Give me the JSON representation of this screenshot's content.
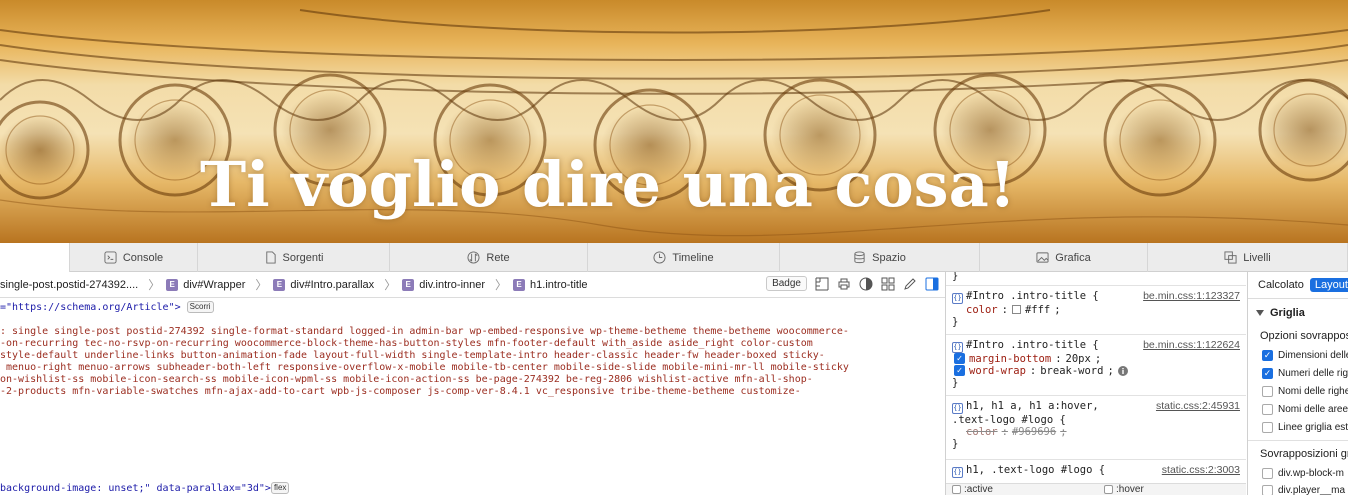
{
  "hero": {
    "title": "Ti voglio dire una cosa!"
  },
  "tabs": [
    {
      "label": "",
      "icon": "elements-icon"
    },
    {
      "label": "Console",
      "icon": "console-icon"
    },
    {
      "label": "Sorgenti",
      "icon": "document-icon"
    },
    {
      "label": "Rete",
      "icon": "network-icon"
    },
    {
      "label": "Timeline",
      "icon": "clock-icon"
    },
    {
      "label": "Spazio",
      "icon": "storage-icon"
    },
    {
      "label": "Grafica",
      "icon": "image-icon"
    },
    {
      "label": "Livelli",
      "icon": "layers-icon"
    }
  ],
  "breadcrumb": {
    "items": [
      {
        "label": "single-post.postid-274392....",
        "has_badge": false
      },
      {
        "label": "div#Wrapper",
        "has_badge": true
      },
      {
        "label": "div#Intro.parallax",
        "has_badge": true
      },
      {
        "label": "div.intro-inner",
        "has_badge": true
      },
      {
        "label": "h1.intro-title",
        "has_badge": true
      }
    ],
    "badge_letter": "E",
    "badge_button": "Badge"
  },
  "dom": {
    "line1_attr": "=\"https://schema.org/Article\">",
    "line1_pill": "Scorri",
    "class_lines": [
      ": single single-post postid-274392 single-format-standard logged-in admin-bar wp-embed-responsive wp-theme-betheme theme-betheme woocommerce-",
      "-on-recurring tec-no-rsvp-on-recurring woocommerce-block-theme-has-button-styles mfn-footer-default with_aside aside_right color-custom",
      "style-default underline-links button-animation-fade layout-full-width single-template-intro header-classic header-fw header-boxed sticky-",
      " menuo-right menuo-arrows subheader-both-left responsive-overflow-x-mobile mobile-tb-center mobile-side-slide mobile-mini-mr-ll mobile-sticky",
      "on-wishlist-ss mobile-icon-search-ss mobile-icon-wpml-ss mobile-icon-action-ss be-page-274392 be-reg-2806 wishlist-active mfn-all-shop-",
      "-2-products mfn-variable-swatches mfn-ajax-add-to-cart wpb-js-composer js-comp-ver-8.4.1 vc_responsive tribe-theme-betheme customize-"
    ],
    "last_line": "background-image: unset;\" data-parallax=\"3d\">",
    "last_pill": "flex"
  },
  "styles": {
    "top_brace": "}",
    "rules": [
      {
        "selector": "#Intro .intro-title {",
        "source": "be.min.css:1:123327",
        "props": [
          {
            "name": "color",
            "value": "#fff",
            "swatch": true,
            "checked": false,
            "struck": false
          }
        ],
        "close": "}"
      },
      {
        "selector": "#Intro .intro-title {",
        "source": "be.min.css:1:122624",
        "props": [
          {
            "name": "margin-bottom",
            "value": "20px",
            "swatch": false,
            "checked": true,
            "struck": false
          },
          {
            "name": "word-wrap",
            "value": "break-word",
            "swatch": false,
            "checked": true,
            "struck": false
          }
        ],
        "close": "}"
      },
      {
        "selector": "h1, h1 a, h1 a:hover,",
        "selector2": ".text-logo #logo {",
        "source": "static.css:2:45931",
        "props": [
          {
            "name": "color",
            "value": "#969696",
            "swatch": false,
            "checked": false,
            "struck": true
          }
        ],
        "close": "}"
      },
      {
        "selector": "h1, .text-logo #logo {",
        "source": "static.css:2:3003",
        "props": [],
        "close": ""
      }
    ],
    "filter_active": ":active",
    "filter_hover": ":hover"
  },
  "layout": {
    "tab_calc": "Calcolato",
    "tab_layout": "Layout",
    "section_grid": "Griglia",
    "overlay_options": "Opzioni sovrapposizione",
    "options": [
      {
        "label": "Dimensioni delle tracce",
        "checked": true
      },
      {
        "label": "Numeri delle righe",
        "checked": true
      },
      {
        "label": "Nomi delle righe",
        "checked": false
      },
      {
        "label": "Nomi delle aree",
        "checked": false
      },
      {
        "label": "Linee griglia estese",
        "checked": false
      }
    ],
    "overlays_title": "Sovrapposizioni griglia",
    "overlays": [
      {
        "label": "div.wp-block-m",
        "checked": false
      },
      {
        "label": "div.player__ma",
        "checked": false
      }
    ]
  }
}
